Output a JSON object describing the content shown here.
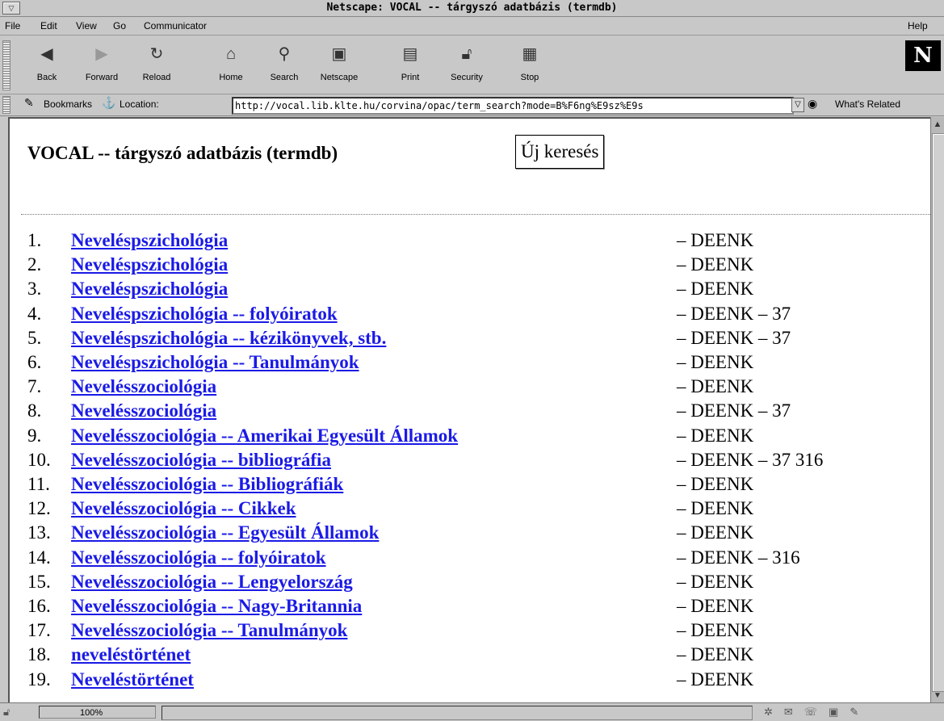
{
  "window": {
    "title": "Netscape: VOCAL -- tárgyszó adatbázis (termdb)",
    "window_menu_glyph": "▽"
  },
  "menubar": {
    "file": "File",
    "edit": "Edit",
    "view": "View",
    "go": "Go",
    "communicator": "Communicator",
    "help": "Help"
  },
  "toolbar": {
    "back": "Back",
    "forward": "Forward",
    "reload": "Reload",
    "home": "Home",
    "search": "Search",
    "netscape": "Netscape",
    "print": "Print",
    "security": "Security",
    "stop": "Stop",
    "logo": "N"
  },
  "location_bar": {
    "bookmarks": "Bookmarks",
    "location_label": "Location:",
    "url": "http://vocal.lib.klte.hu/corvina/opac/term_search?mode=B%F6ng%E9sz%E9s",
    "whats_related": "What's Related"
  },
  "page": {
    "heading": "VOCAL -- tárgyszó adatbázis (termdb)",
    "new_search_button": "Új keresés"
  },
  "results": [
    {
      "num": "1.",
      "term": "Neveléspszichológia",
      "source": "– DEENK"
    },
    {
      "num": "2.",
      "term": "Neveléspszichológia",
      "source": "– DEENK"
    },
    {
      "num": "3.",
      "term": "Neveléspszichológia",
      "source": "– DEENK"
    },
    {
      "num": "4.",
      "term": "Neveléspszichológia -- folyóiratok",
      "source": "– DEENK  – 37"
    },
    {
      "num": "5.",
      "term": "Neveléspszichológia -- kézikönyvek, stb.",
      "source": "– DEENK  – 37"
    },
    {
      "num": "6.",
      "term": "Neveléspszichológia -- Tanulmányok",
      "source": "– DEENK"
    },
    {
      "num": "7.",
      "term": "Nevelésszociológia",
      "source": "– DEENK"
    },
    {
      "num": "8.",
      "term": "Nevelésszociológia",
      "source": "– DEENK  – 37"
    },
    {
      "num": "9.",
      "term": "Nevelésszociológia -- Amerikai Egyesült Államok",
      "source": "– DEENK"
    },
    {
      "num": "10.",
      "term": "Nevelésszociológia -- bibliográfia",
      "source": "– DEENK  – 37 316"
    },
    {
      "num": "11.",
      "term": "Nevelésszociológia -- Bibliográfiák",
      "source": "– DEENK"
    },
    {
      "num": "12.",
      "term": "Nevelésszociológia -- Cikkek",
      "source": "– DEENK"
    },
    {
      "num": "13.",
      "term": "Nevelésszociológia -- Egyesült Államok",
      "source": "– DEENK"
    },
    {
      "num": "14.",
      "term": "Nevelésszociológia -- folyóiratok",
      "source": "– DEENK  – 316"
    },
    {
      "num": "15.",
      "term": "Nevelésszociológia -- Lengyelország",
      "source": "– DEENK"
    },
    {
      "num": "16.",
      "term": "Nevelésszociológia -- Nagy-Britannia",
      "source": "– DEENK"
    },
    {
      "num": "17.",
      "term": "Nevelésszociológia -- Tanulmányok",
      "source": "– DEENK"
    },
    {
      "num": "18.",
      "term": "neveléstörténet",
      "source": "– DEENK"
    },
    {
      "num": "19.",
      "term": "Neveléstörténet",
      "source": "– DEENK"
    }
  ],
  "statusbar": {
    "progress": "100%"
  },
  "colors": {
    "link": "#1a1ae6",
    "chrome": "#c8c8c8"
  }
}
